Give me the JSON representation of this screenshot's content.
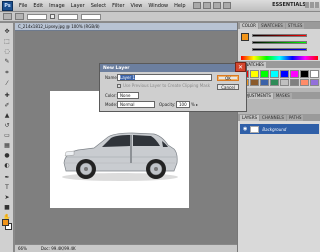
{
  "menubar": {
    "logo": "Ps",
    "items": [
      "File",
      "Edit",
      "Image",
      "Layer",
      "Select",
      "Filter",
      "View",
      "Window",
      "Help"
    ],
    "workspace": "ESSENTIALS"
  },
  "document": {
    "tab": "C_214x1812_Lipsey.jpg @ 100% (RGB/8)",
    "status_zoom": "66%",
    "status_doc": "Doc: 99.4K/99.4K"
  },
  "panels": {
    "top_tabs": [
      "COLOR",
      "SWATCHES",
      "STYLES"
    ],
    "lower_tabs": [
      "ADJUSTMENTS",
      "MASKS"
    ],
    "layers_tabs": [
      "LAYERS",
      "CHANNELS",
      "PATHS"
    ],
    "layer_name": "Background",
    "colors": {
      "foreground": "#f19419",
      "background": "#ffffff",
      "swatches": [
        "#ff0000",
        "#ffff00",
        "#00ff00",
        "#00ffff",
        "#0000ff",
        "#ff00ff",
        "#000000",
        "#ffffff",
        "#f19419",
        "#8a5a2b",
        "#3b62a8",
        "#2e8b57",
        "#c0c0c0",
        "#808080",
        "#ff8c69",
        "#9370db"
      ]
    }
  },
  "dialog": {
    "title": "New Layer",
    "name_label": "Name:",
    "name_value": "Layer 1",
    "use_previous": "Use Previous Layer to Create Clipping Mask",
    "color_label": "Color:",
    "color_value": "None",
    "mode_label": "Mode:",
    "mode_value": "Normal",
    "opacity_label": "Opacity:",
    "opacity_value": "100",
    "opacity_unit": "%",
    "ok_label": "OK",
    "cancel_label": "Cancel",
    "close_glyph": "✕"
  }
}
